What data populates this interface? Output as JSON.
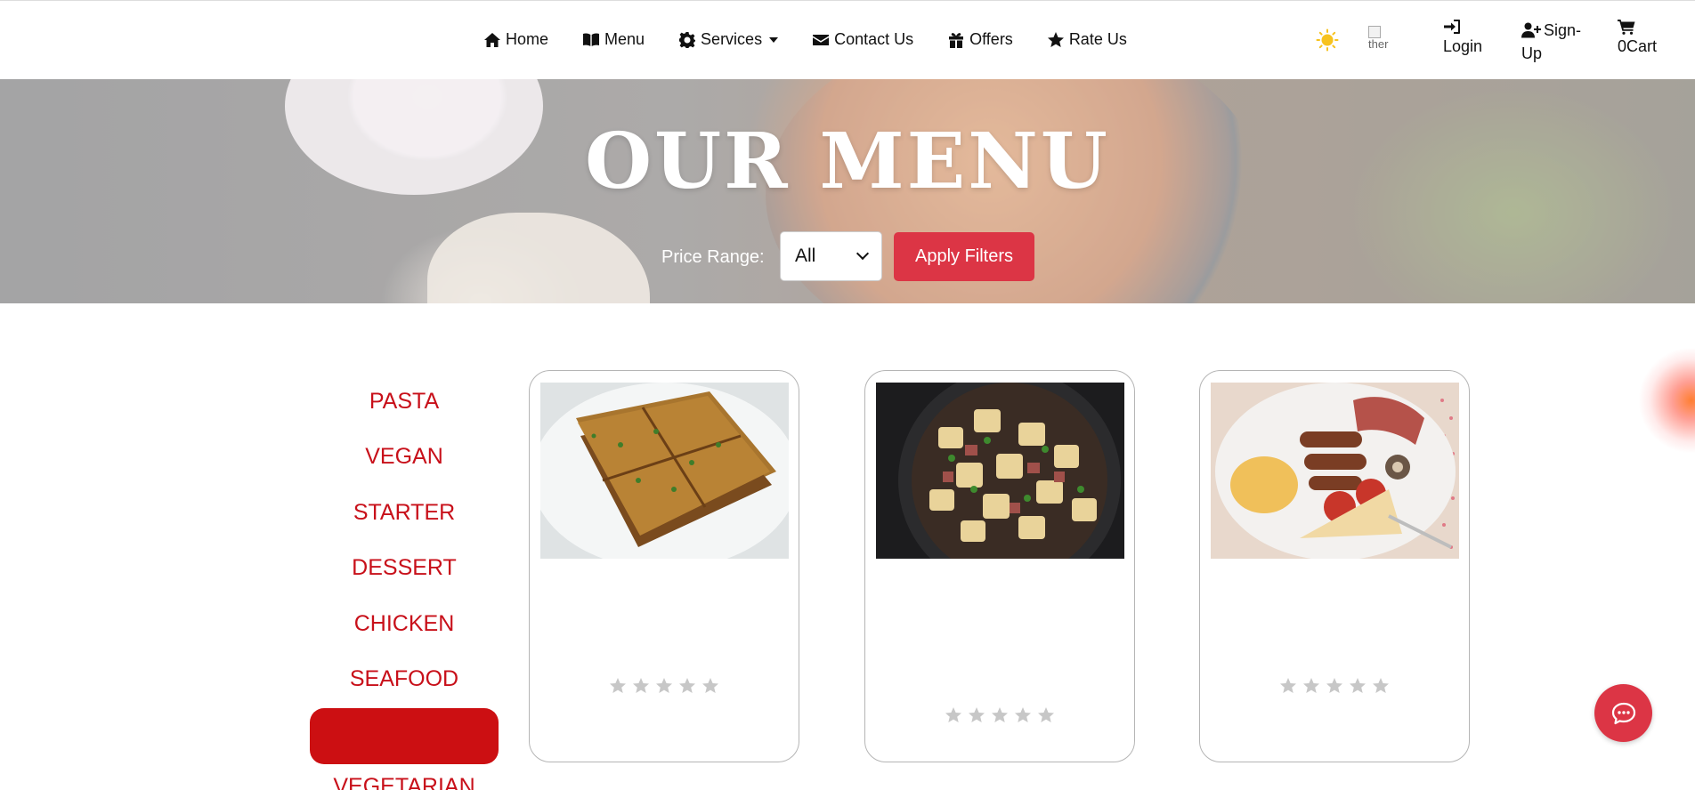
{
  "nav": {
    "links": [
      {
        "label": "Home",
        "icon": "home-icon"
      },
      {
        "label": "Menu",
        "icon": "book-icon"
      },
      {
        "label": "Services",
        "icon": "gear-icon"
      },
      {
        "label": "Contact Us",
        "icon": "envelope-icon"
      },
      {
        "label": "Offers",
        "icon": "gift-icon"
      },
      {
        "label": "Rate Us",
        "icon": "star-icon"
      }
    ],
    "theme_icon": "sun-icon",
    "theme_img_alt": "ther",
    "login_label": "Login",
    "signup_label_1": "Sign-",
    "signup_label_2": "Up",
    "cart_count": "0",
    "cart_label": "Cart"
  },
  "hero": {
    "title": "OUR MENU",
    "price_label": "Price Range:",
    "price_selected": "All",
    "apply_label": "Apply Filters"
  },
  "categories": [
    "PASTA",
    "VEGAN",
    "STARTER",
    "DESSERT",
    "CHICKEN",
    "SEAFOOD",
    "",
    "VEGETARIAN"
  ],
  "cards": [
    {
      "image": "french-toast-photo",
      "rating": 0,
      "max_rating": 5
    },
    {
      "image": "potato-hash-skillet-photo",
      "rating": 0,
      "max_rating": 5
    },
    {
      "image": "full-breakfast-plate-photo",
      "rating": 0,
      "max_rating": 5
    }
  ],
  "colors": {
    "accent": "#dc3545",
    "category_text": "#c8101a",
    "active_category": "#cc0f12",
    "star_empty": "#c7c7c7"
  },
  "chat_icon": "chat-bubble-icon"
}
